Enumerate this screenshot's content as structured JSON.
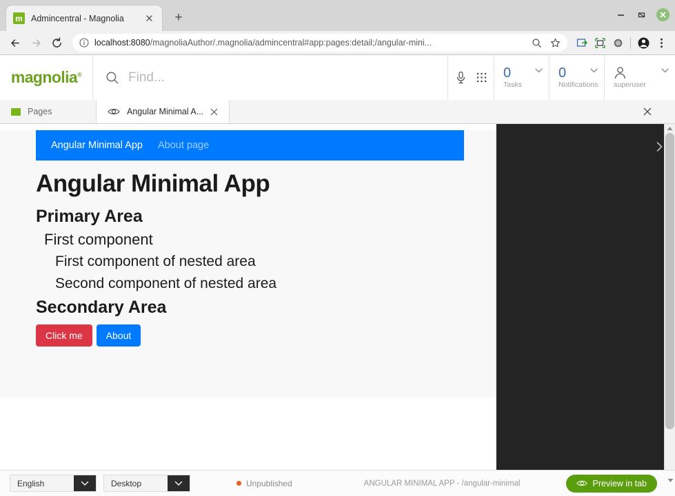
{
  "browser": {
    "tab": {
      "title": "Admincentral - Magnolia",
      "favicon_letter": "m",
      "favicon_name": "magnolia-favicon"
    },
    "new_tab_label": "+",
    "window": {
      "minimize": "–",
      "maximize": "❐",
      "close": "✕"
    },
    "nav": {
      "back": "←",
      "forward": "→",
      "reload": "↻"
    },
    "url": {
      "host": "localhost:8080",
      "path": "/magnoliaAuthor/.magnolia/admincentral#app:pages:detail;/angular-mini...",
      "info_icon": "info-circle-icon",
      "zoom_icon": "zoom-out-icon",
      "bookmark_icon": "star-icon"
    },
    "toolbar_icons": [
      "share-extension-icon",
      "screenshot-extension-icon",
      "gear-extension-icon",
      "profile-avatar-icon",
      "kebab-menu-icon"
    ]
  },
  "magnolia": {
    "logo": "magnolia",
    "logo_mark": "®",
    "search": {
      "placeholder": "Find...",
      "icon": "search-icon"
    },
    "header_icons": [
      "microphone-icon",
      "apps-grid-icon"
    ],
    "tasks": {
      "count": "0",
      "label": "Tasks"
    },
    "notifications": {
      "count": "0",
      "label": "Notifications"
    },
    "user": {
      "name": "superuser",
      "icon": "user-icon"
    },
    "app_tabs": [
      {
        "label": "Pages",
        "icon": "pages-green-icon",
        "active": false,
        "closable": false
      },
      {
        "label": "Angular Minimal A...",
        "icon": "eye-icon",
        "active": true,
        "closable": true
      }
    ],
    "close_all_label": "✕"
  },
  "page_preview": {
    "nav": {
      "brand": "Angular Minimal App",
      "link": "About page"
    },
    "heading": "Angular Minimal App",
    "primary_area": {
      "title": "Primary Area",
      "component": "First component",
      "nested": [
        "First component of nested area",
        "Second component of nested area"
      ]
    },
    "secondary_area": {
      "title": "Secondary Area",
      "buttons": [
        {
          "label": "Click me",
          "style": "danger",
          "color": "#dc3545"
        },
        {
          "label": "About",
          "style": "primary",
          "color": "#007bff"
        }
      ]
    }
  },
  "right_panel": {
    "collapse_icon": "chevron-right-icon"
  },
  "statusbar": {
    "language": {
      "value": "English",
      "chevron": "chevron-down-icon"
    },
    "device": {
      "value": "Desktop",
      "chevron": "chevron-down-icon"
    },
    "status": {
      "label": "Unpublished",
      "dot_color": "#e8601c"
    },
    "page_info": "ANGULAR MINIMAL APP - /angular-minimal",
    "preview_button": {
      "label": "Preview in tab",
      "icon": "eye-icon",
      "color": "#5a9e0e"
    }
  }
}
